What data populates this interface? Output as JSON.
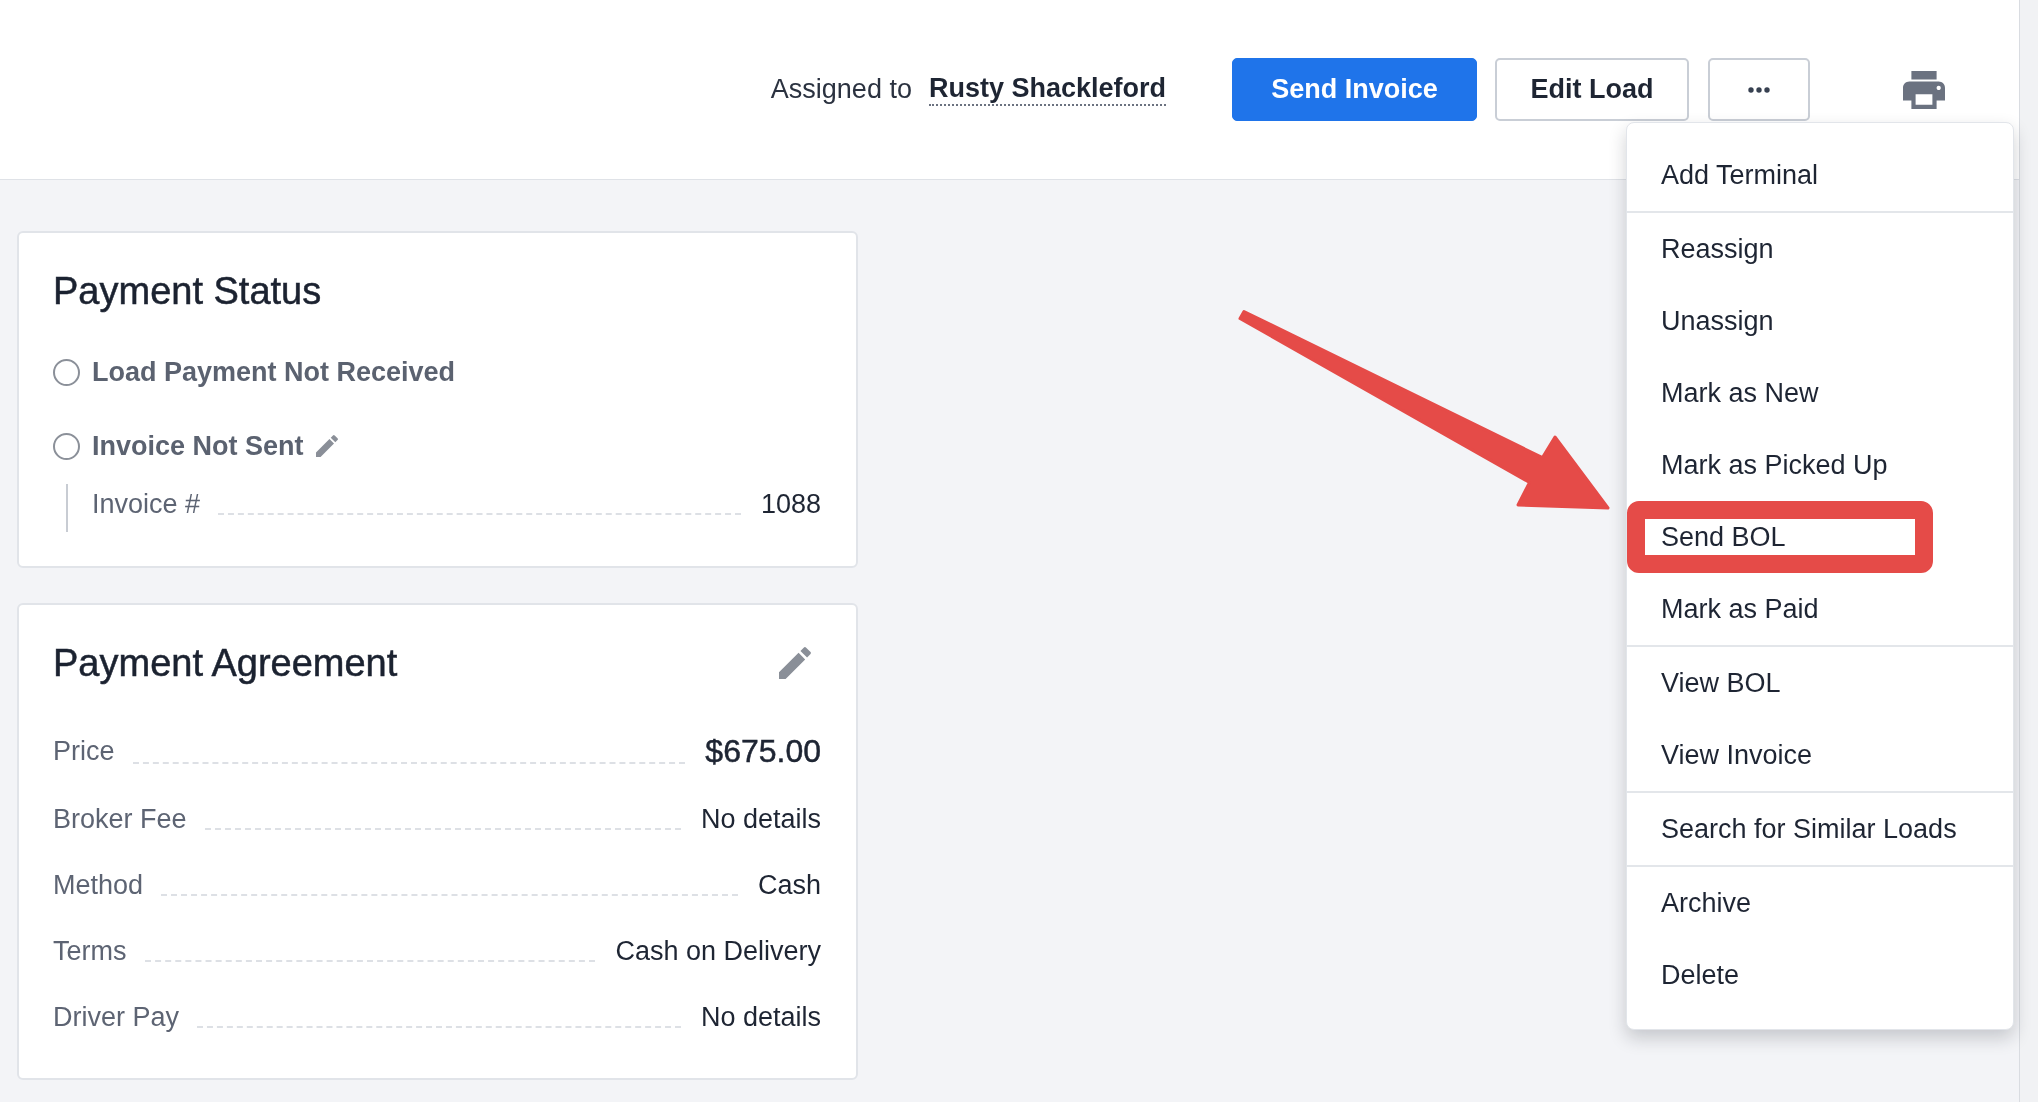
{
  "header": {
    "assigned_label": "Assigned to",
    "assignee": "Rusty Shackleford",
    "buttons": [
      {
        "kind": "primary",
        "label": "Send Invoice"
      },
      {
        "kind": "outline",
        "label": "Edit Load"
      },
      {
        "kind": "more",
        "menu": {
          "sections": [
            {
              "items": [
                {
                  "label": "Add Terminal",
                  "highlighted": false
                }
              ]
            },
            {
              "items": [
                {
                  "label": "Reassign",
                  "highlighted": false
                },
                {
                  "label": "Unassign",
                  "highlighted": false
                },
                {
                  "label": "Mark as New",
                  "highlighted": false
                },
                {
                  "label": "Mark as Picked Up",
                  "highlighted": false
                },
                {
                  "label": "Send BOL",
                  "highlighted": true
                },
                {
                  "label": "Mark as Paid",
                  "highlighted": false
                }
              ]
            },
            {
              "items": [
                {
                  "label": "View BOL",
                  "highlighted": false
                },
                {
                  "label": "View Invoice",
                  "highlighted": false
                }
              ]
            },
            {
              "items": [
                {
                  "label": "Search for Similar Loads",
                  "highlighted": false
                }
              ]
            },
            {
              "items": [
                {
                  "label": "Archive",
                  "highlighted": false
                },
                {
                  "label": "Delete",
                  "highlighted": false
                }
              ]
            }
          ]
        }
      },
      {
        "kind": "print"
      }
    ]
  },
  "payment_status": {
    "title": "Payment Status",
    "options": [
      {
        "label": "Load Payment Not Received",
        "checked": false,
        "editable": false
      },
      {
        "label": "Invoice Not Sent",
        "checked": false,
        "editable": true,
        "details": [
          {
            "label": "Invoice #",
            "value": "1088"
          }
        ]
      }
    ]
  },
  "payment_agreement": {
    "title": "Payment Agreement",
    "editable": true,
    "rows": [
      {
        "label": "Price",
        "value": "$675.00",
        "emphasis": true
      },
      {
        "label": "Broker Fee",
        "value": "No details",
        "emphasis": false
      },
      {
        "label": "Method",
        "value": "Cash",
        "emphasis": false
      },
      {
        "label": "Terms",
        "value": "Cash on Delivery",
        "emphasis": false
      },
      {
        "label": "Driver Pay",
        "value": "No details",
        "emphasis": false
      }
    ]
  }
}
